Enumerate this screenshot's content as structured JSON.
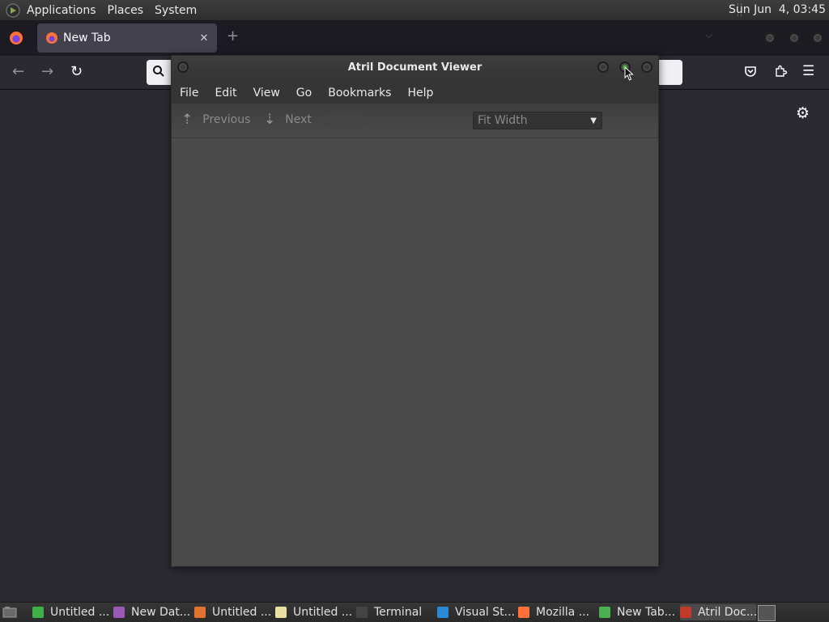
{
  "top_panel": {
    "menus": [
      "Applications",
      "Places",
      "System"
    ],
    "clock": "Sun Jun  4, 03:45"
  },
  "firefox": {
    "tab_title": "New Tab",
    "tab_close": "✕",
    "new_tab": "+",
    "list_all_tabs": "⌵",
    "back": "←",
    "forward": "→",
    "reload": "↻",
    "url_search_icon": "🔍",
    "pocket_icon": "pocket-icon",
    "extensions_icon": "puzzle-icon",
    "menu_icon": "☰",
    "settings_icon": "⚙"
  },
  "atril": {
    "title": "Atril Document Viewer",
    "menus": [
      "File",
      "Edit",
      "View",
      "Go",
      "Bookmarks",
      "Help"
    ],
    "toolbar": {
      "previous_label": "Previous",
      "previous_icon": "⇡",
      "next_label": "Next",
      "next_icon": "⇣",
      "zoom_value": "Fit Width",
      "zoom_arrow": "▼"
    }
  },
  "taskbar": {
    "items": [
      {
        "label": "Untitled ...",
        "icon": "spreadsheet-icon",
        "color": "#3fae49"
      },
      {
        "label": "New Dat...",
        "icon": "database-icon",
        "color": "#9b59b6"
      },
      {
        "label": "Untitled ...",
        "icon": "presentation-icon",
        "color": "#e0732f"
      },
      {
        "label": "Untitled ...",
        "icon": "document-icon",
        "color": "#e8e0a0"
      },
      {
        "label": "Terminal",
        "icon": "terminal-icon",
        "color": "#444444"
      },
      {
        "label": "Visual St...",
        "icon": "vscode-icon",
        "color": "#2b8ad6"
      },
      {
        "label": "Mozilla ...",
        "icon": "firefox-icon",
        "color": "#ff7139"
      },
      {
        "label": "New Tab...",
        "icon": "chrome-icon",
        "color": "#4caf50"
      },
      {
        "label": "Atril Doc...",
        "icon": "atril-icon",
        "color": "#c0392b"
      }
    ]
  }
}
